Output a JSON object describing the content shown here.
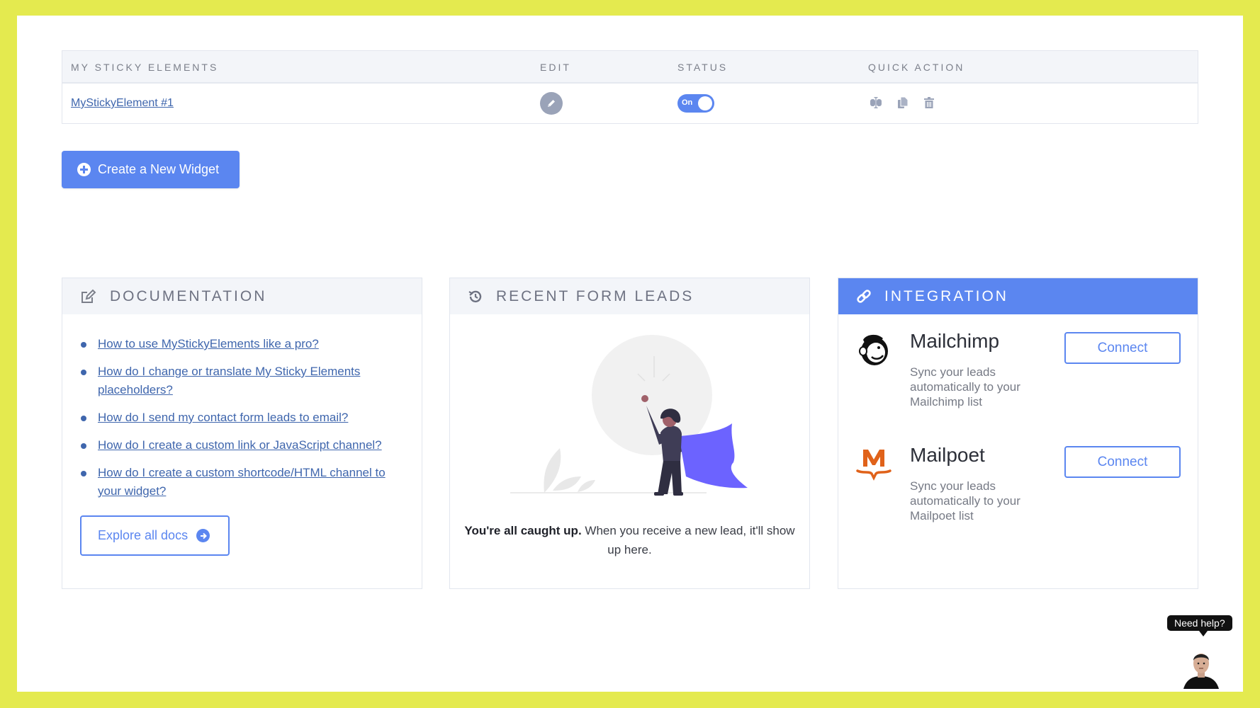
{
  "table": {
    "headers": {
      "name": "MY STICKY ELEMENTS",
      "edit": "EDIT",
      "status": "STATUS",
      "quick_action": "QUICK ACTION"
    },
    "rows": [
      {
        "name": "MyStickyElement #1",
        "status_label": "On",
        "status_on": true,
        "quick_actions": [
          "rename-icon",
          "duplicate-icon",
          "trash-icon"
        ]
      }
    ]
  },
  "create_button": {
    "label": "Create a New Widget",
    "icon": "plus-circle-icon"
  },
  "documentation": {
    "title": "DOCUMENTATION",
    "icon": "edit-square-icon",
    "links": [
      "How to use MyStickyElements like a pro?",
      "How do I change or translate My Sticky Elements placeholders?",
      "How do I send my contact form leads to email?",
      "How do I create a custom link or JavaScript channel?",
      "How do I create a custom shortcode/HTML channel to your widget?"
    ],
    "explore_label": "Explore all docs",
    "explore_icon": "arrow-right-circle-icon"
  },
  "recent_leads": {
    "title": "RECENT FORM LEADS",
    "icon": "history-icon",
    "empty_bold": "You're all caught up.",
    "empty_text": " When you receive a new lead, it'll show up here."
  },
  "integration": {
    "title": "INTEGRATION",
    "icon": "link-icon",
    "items": [
      {
        "name": "Mailchimp",
        "description": "Sync your leads automatically to your Mailchimp list",
        "button": "Connect",
        "logo": "mailchimp-logo"
      },
      {
        "name": "Mailpoet",
        "description": "Sync your leads automatically to your Mailpoet list",
        "button": "Connect",
        "logo": "mailpoet-logo"
      }
    ]
  },
  "help": {
    "label": "Need help?"
  },
  "colors": {
    "accent": "#5b86f0",
    "link": "#3f66ad",
    "frame": "#e4ea4f",
    "mailpoet": "#e0621a"
  }
}
